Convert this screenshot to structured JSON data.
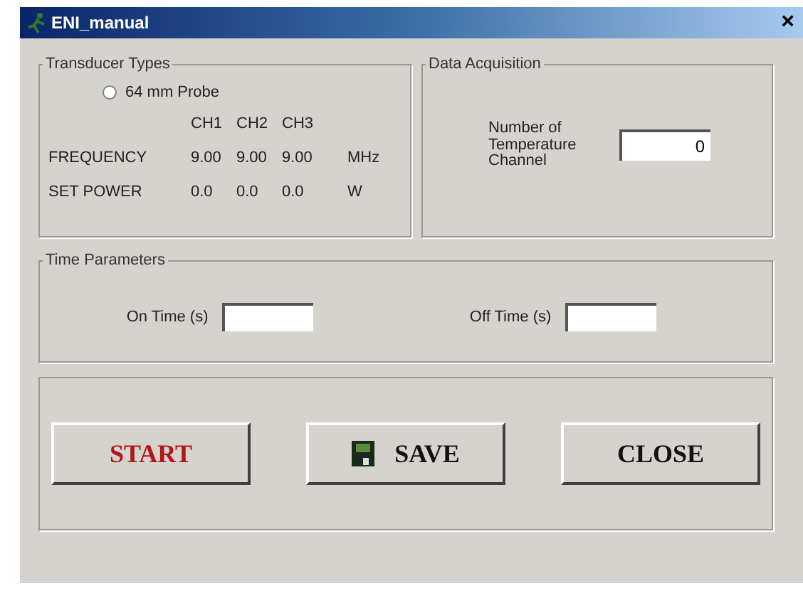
{
  "window": {
    "title": "ENI_manual",
    "close": "×"
  },
  "transducer_types": {
    "title": "Transducer Types",
    "probe": {
      "label": "64 mm Probe",
      "selected": false
    },
    "columns": [
      "CH1",
      "CH2",
      "CH3"
    ],
    "rows": [
      {
        "label": "FREQUENCY",
        "values": [
          "9.00",
          "9.00",
          "9.00"
        ],
        "unit": "MHz"
      },
      {
        "label": "SET POWER",
        "values": [
          "0.0",
          "0.0",
          "0.0"
        ],
        "unit": "W"
      }
    ]
  },
  "data_acquisition": {
    "title": "Data Acquisition",
    "label": "Number of Temperature Channel",
    "value": "0"
  },
  "time_parameters": {
    "title": "Time Parameters",
    "fields": [
      {
        "label": "On Time (s)"
      },
      {
        "label": "Off Time (s)"
      }
    ]
  },
  "buttons": [
    {
      "label": "START",
      "kind": "start"
    },
    {
      "label": "SAVE",
      "kind": "save"
    },
    {
      "label": "CLOSE",
      "kind": "close"
    }
  ]
}
